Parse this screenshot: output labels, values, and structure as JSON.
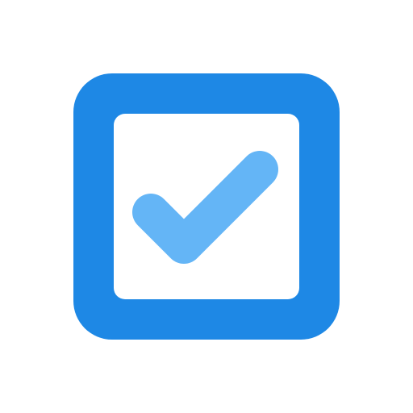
{
  "icon": {
    "name": "checked-checkbox-icon",
    "state": "checked",
    "colors": {
      "frame": "#1E88E5",
      "checkmark": "#64B5F6",
      "inner": "#FFFFFF",
      "background": "#FFFFFF"
    }
  }
}
